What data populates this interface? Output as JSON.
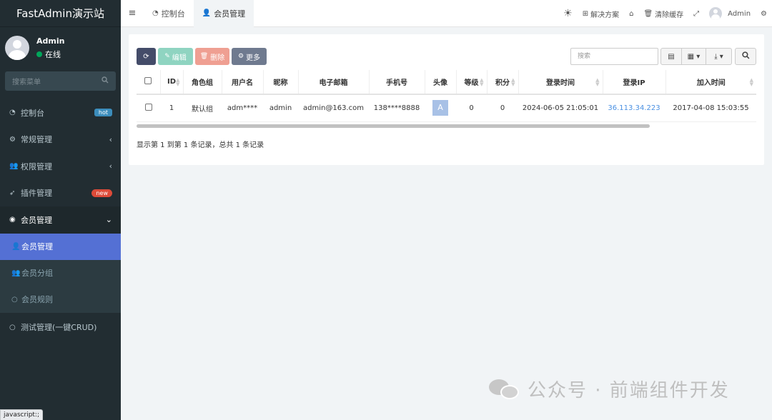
{
  "sidebar": {
    "logo": "FastAdmin演示站",
    "user": {
      "name": "Admin",
      "status": "在线"
    },
    "search_placeholder": "搜索菜单",
    "items": [
      {
        "label": "控制台",
        "icon": "dashboard-icon",
        "badge": "hot"
      },
      {
        "label": "常规管理",
        "icon": "cogs-icon",
        "chevron": "‹"
      },
      {
        "label": "权限管理",
        "icon": "users-icon",
        "chevron": "‹"
      },
      {
        "label": "插件管理",
        "icon": "rocket-icon",
        "badge": "new"
      },
      {
        "label": "会员管理",
        "icon": "user-circle-icon",
        "chevron": "⌄"
      }
    ],
    "submenu": [
      {
        "label": "会员管理",
        "icon": "user-icon",
        "active": true
      },
      {
        "label": "会员分组",
        "icon": "users-icon"
      },
      {
        "label": "会员规则",
        "icon": "circle-icon"
      }
    ],
    "last_item": {
      "label": "测试管理(一键CRUD)",
      "icon": "circle-icon"
    }
  },
  "status_url": "javascript:;",
  "topbar": {
    "tabs": [
      {
        "label": "控制台",
        "icon": "dashboard-icon"
      },
      {
        "label": "会员管理",
        "icon": "user-icon",
        "active": true
      }
    ],
    "right": {
      "solutions": "解决方案",
      "clear_cache": "清除缓存",
      "user": "Admin"
    }
  },
  "toolbar": {
    "edit": "编辑",
    "delete": "删除",
    "more": "更多",
    "search_placeholder": "搜索"
  },
  "table": {
    "columns": [
      "ID",
      "角色组",
      "用户名",
      "昵称",
      "电子邮箱",
      "手机号",
      "头像",
      "等级",
      "积分",
      "登录时间",
      "登录IP",
      "加入时间"
    ],
    "rows": [
      {
        "id": "1",
        "group": "默认组",
        "username": "adm****",
        "nickname": "admin",
        "email": "admin@163.com",
        "mobile": "138****8888",
        "avatar": "A",
        "level": "0",
        "score": "0",
        "login_time": "2024-06-05 21:05:01",
        "login_ip": "36.113.34.223",
        "join_time": "2017-04-08 15:03:55"
      }
    ],
    "summary": "显示第 1 到第 1 条记录，总共 1 条记录"
  },
  "watermark": "公众号 · 前端组件开发"
}
